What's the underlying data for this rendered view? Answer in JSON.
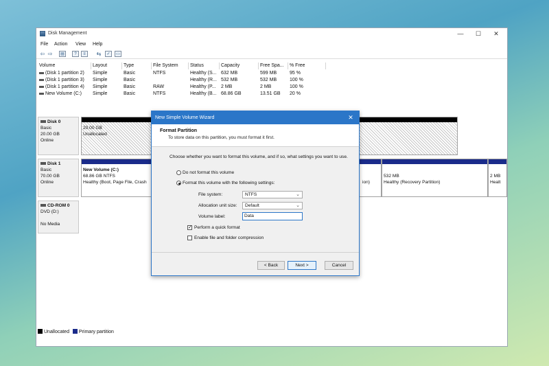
{
  "window": {
    "title": "Disk Management",
    "minimize_glyph": "—",
    "maximize_glyph": "☐",
    "close_glyph": "✕"
  },
  "menu": [
    "File",
    "Action",
    "View",
    "Help"
  ],
  "toolbar_icons": [
    "back-icon",
    "forward-icon",
    "properties-icon",
    "help-icon",
    "list-icon",
    "connect-icon",
    "check-icon",
    "drive-icon"
  ],
  "volume_table": {
    "headers": [
      "Volume",
      "Layout",
      "Type",
      "File System",
      "Status",
      "Capacity",
      "Free Spa...",
      "% Free"
    ],
    "rows": [
      [
        "(Disk 1 partition 2)",
        "Simple",
        "Basic",
        "NTFS",
        "Healthy (S...",
        "632 MB",
        "599 MB",
        "95 %"
      ],
      [
        "(Disk 1 partition 3)",
        "Simple",
        "Basic",
        "",
        "Healthy (R...",
        "532 MB",
        "532 MB",
        "100 %"
      ],
      [
        "(Disk 1 partition 4)",
        "Simple",
        "Basic",
        "RAW",
        "Healthy (P...",
        "2 MB",
        "2 MB",
        "100 %"
      ],
      [
        "New Volume (C:)",
        "Simple",
        "Basic",
        "NTFS",
        "Healthy (B...",
        "68.86 GB",
        "13.51 GB",
        "20 %"
      ]
    ]
  },
  "disks": {
    "disk0": {
      "name": "Disk 0",
      "type": "Basic",
      "size": "20.00 GB",
      "status": "Online",
      "partition_size": "20.00 GB",
      "partition_state": "Unallocated"
    },
    "disk1": {
      "name": "Disk 1",
      "type": "Basic",
      "size": "70.00 GB",
      "status": "Online",
      "p1_name": "New Volume  (C:)",
      "p1_size": "68.86 GB NTFS",
      "p1_status": "Healthy (Boot, Page File, Crash",
      "p2_status_tail": "ion)",
      "p3_size": "532 MB",
      "p3_status": "Healthy (Recovery Partition)",
      "p4_size": "2 MB",
      "p4_status": "Healt"
    },
    "cdrom": {
      "name": "CD-ROM 0",
      "drive": "DVD (D:)",
      "media": "No Media"
    }
  },
  "legend": {
    "unallocated": "Unallocated",
    "primary": "Primary partition",
    "unallocated_color": "#000000",
    "primary_color": "#1a2b8a"
  },
  "wizard": {
    "title": "New Simple Volume Wizard",
    "close_glyph": "✕",
    "heading": "Format Partition",
    "subheading": "To store data on this partition, you must format it first.",
    "instruction": "Choose whether you want to format this volume, and if so, what settings you want to use.",
    "option_no_format": "Do not format this volume",
    "option_format": "Format this volume with the following settings:",
    "file_system_label": "File system:",
    "file_system_value": "NTFS",
    "alloc_label": "Allocation unit size:",
    "alloc_value": "Default",
    "volume_label_label": "Volume label:",
    "volume_label_value": "Data",
    "quick_format": "Perform a quick format",
    "quick_format_checked": true,
    "compression": "Enable file and folder compression",
    "compression_checked": false,
    "back": "< Back",
    "next": "Next >",
    "cancel": "Cancel",
    "accent_color": "#2b76c8"
  }
}
